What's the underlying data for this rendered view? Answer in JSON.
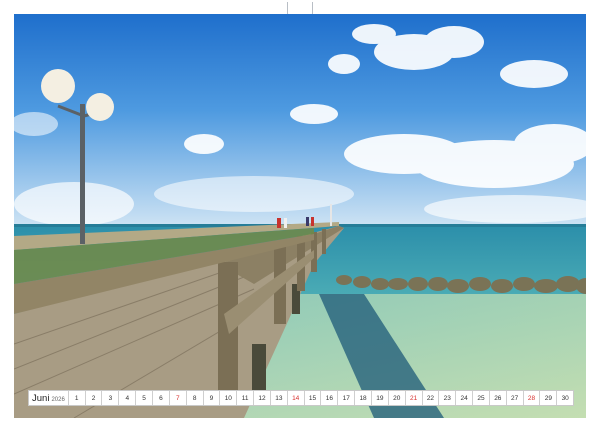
{
  "calendar": {
    "month": "Juni",
    "year": "2026",
    "days": [
      "1",
      "2",
      "3",
      "4",
      "5",
      "6",
      "7",
      "8",
      "9",
      "10",
      "11",
      "12",
      "13",
      "14",
      "15",
      "16",
      "17",
      "18",
      "19",
      "20",
      "21",
      "22",
      "23",
      "24",
      "25",
      "26",
      "27",
      "28",
      "29",
      "30"
    ],
    "sundays": [
      7,
      14,
      21,
      28
    ],
    "holiday_color": "#d8312f"
  },
  "photo": {
    "subject": "wooden-pier-over-baltic-sea",
    "sky_color": "#3a8fd8",
    "sea_color": "#2f9fb8"
  }
}
